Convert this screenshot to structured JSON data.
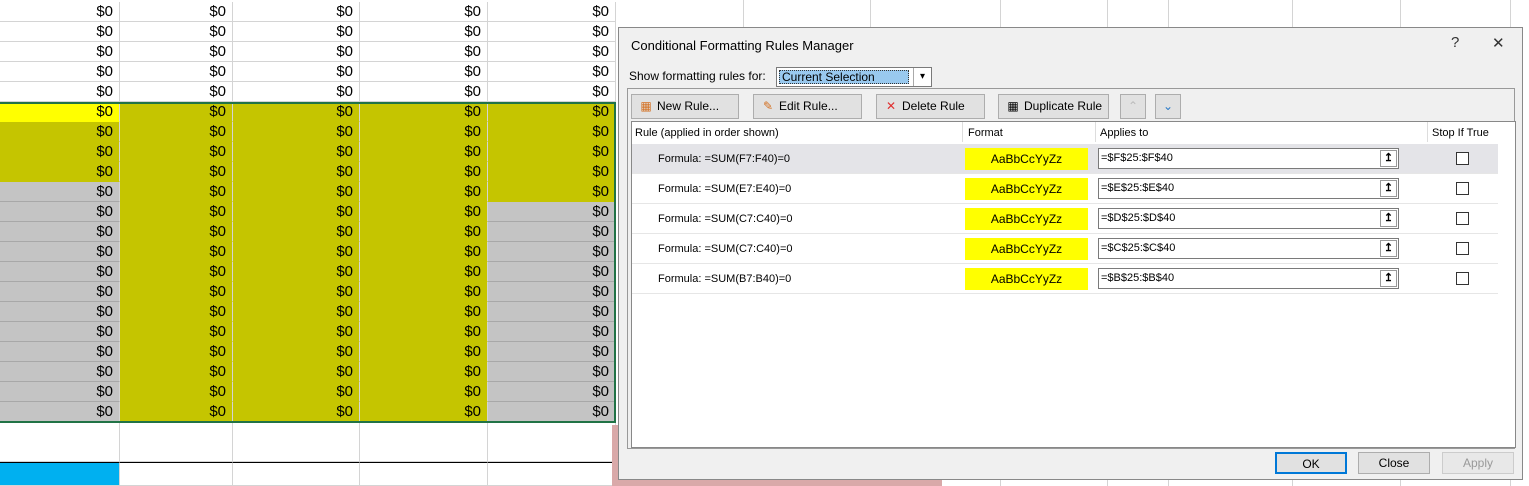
{
  "sheet": {
    "cell_value": "$0",
    "colors": {
      "yellow": "#ffff00",
      "olive": "#c5c500",
      "gray": "#c4c4c4",
      "blue": "#00b0f0",
      "selection": "#217346"
    }
  },
  "dialog": {
    "title": "Conditional Formatting Rules Manager",
    "help": "?",
    "close": "✕",
    "show_label": "Show formatting rules for:",
    "show_value": "Current Selection",
    "buttons": {
      "new": "New Rule...",
      "edit": "Edit Rule...",
      "delete": "Delete Rule",
      "duplicate": "Duplicate Rule",
      "up": "⌃",
      "down": "⌄"
    },
    "columns": {
      "rule": "Rule (applied in order shown)",
      "format": "Format",
      "applies": "Applies to",
      "stop": "Stop If True"
    },
    "rules": [
      {
        "rule": "Formula: =SUM(F7:F40)=0",
        "format": "AaBbCcYyZz",
        "applies": "=$F$25:$F$40",
        "stop": false
      },
      {
        "rule": "Formula: =SUM(E7:E40)=0",
        "format": "AaBbCcYyZz",
        "applies": "=$E$25:$E$40",
        "stop": false
      },
      {
        "rule": "Formula: =SUM(C7:C40)=0",
        "format": "AaBbCcYyZz",
        "applies": "=$D$25:$D$40",
        "stop": false
      },
      {
        "rule": "Formula: =SUM(C7:C40)=0",
        "format": "AaBbCcYyZz",
        "applies": "=$C$25:$C$40",
        "stop": false
      },
      {
        "rule": "Formula: =SUM(B7:B40)=0",
        "format": "AaBbCcYyZz",
        "applies": "=$B$25:$B$40",
        "stop": false
      }
    ],
    "ok": "OK",
    "close_btn": "Close",
    "apply": "Apply"
  }
}
